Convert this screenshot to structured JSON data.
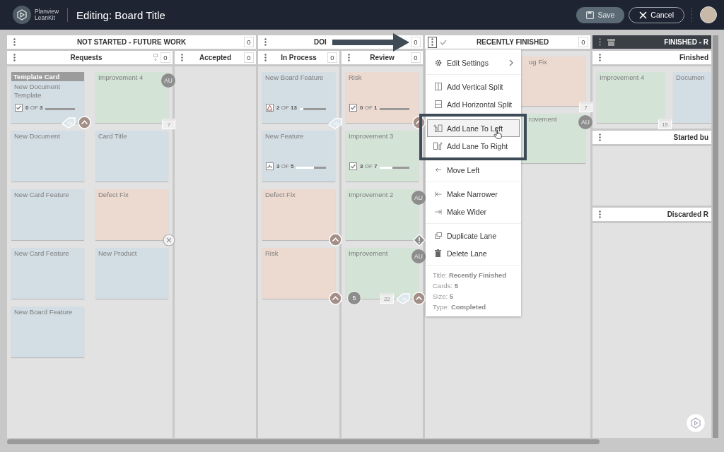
{
  "header": {
    "brand_top": "Planview",
    "brand_bottom": "LeanKit",
    "title": "Editing: Board Title",
    "save": "Save",
    "cancel": "Cancel"
  },
  "columns": [
    {
      "title": "NOT STARTED - FUTURE WORK",
      "count": "0",
      "kind": "normal",
      "menu_open": false,
      "lanes": [
        {
          "title": "Requests",
          "count": "0",
          "wip_icon": true,
          "cards": [
            {
              "header": "Template Card",
              "title": "New Document Template",
              "color": "#d3dde4",
              "progress": {
                "kind": "check",
                "done": "0",
                "of": "OF",
                "total": "3",
                "level": 0
              },
              "badges": [
                {
                  "kind": "tag"
                },
                {
                  "kind": "priority"
                }
              ]
            },
            {
              "title": "Improvement 4",
              "color": "#d3e3d6",
              "badges": [
                {
                  "kind": "avatar",
                  "text": "AU"
                },
                {
                  "kind": "calendar",
                  "text": "?"
                }
              ]
            },
            {
              "title": "New Document",
              "color": "#d3dde4"
            },
            {
              "title": "Card Title",
              "color": "#d3dde4"
            },
            {
              "title": "New Card Feature",
              "color": "#d3dde4"
            },
            {
              "title": "Defect Fix",
              "color": "#ecd9cf",
              "badges": [
                {
                  "kind": "blocked"
                }
              ]
            },
            {
              "title": "New Card Feature",
              "color": "#d3dde4"
            },
            {
              "title": "New Product",
              "color": "#d3dde4"
            },
            {
              "title": "New Board Feature",
              "color": "#d3dde4"
            }
          ]
        },
        {
          "title": "Accepted",
          "count": "0",
          "wip_icon": false
        }
      ]
    },
    {
      "title": "DOI",
      "count": "0",
      "kind": "normal",
      "menu_open": false,
      "lanes": [
        {
          "title": "In Process",
          "count": "0",
          "wip_icon": false,
          "cards": [
            {
              "title": "New Board Feature",
              "color": "#d3dde4",
              "progress": {
                "kind": "warning",
                "done": "2",
                "of": "OF",
                "total": "13",
                "level": 0.15
              },
              "badges": [
                {
                  "kind": "tag"
                }
              ]
            },
            {
              "title": "New Feature",
              "color": "#d3dde4",
              "progress": {
                "kind": "tree",
                "done": "3",
                "of": "OF",
                "total": "5",
                "level": 0.6
              }
            },
            {
              "title": "Defect Fix",
              "color": "#ecd9cf",
              "badges": [
                {
                  "kind": "priority"
                }
              ]
            },
            {
              "title": "Risk",
              "color": "#ecd9cf",
              "badges": [
                {
                  "kind": "priority"
                }
              ]
            }
          ]
        },
        {
          "title": "Review",
          "count": "0",
          "wip_icon": false,
          "cards": [
            {
              "title": "Risk",
              "color": "#ecd9cf",
              "progress": {
                "kind": "check",
                "done": "0",
                "of": "OF",
                "total": "1",
                "level": 0
              },
              "badges": [
                {
                  "kind": "priority"
                }
              ]
            },
            {
              "title": "Improvement 3",
              "color": "#d3e3d6",
              "progress": {
                "kind": "check",
                "done": "3",
                "of": "OF",
                "total": "7",
                "level": 0.43
              }
            },
            {
              "title": "Improvement 2",
              "color": "#d3e3d6",
              "badges": [
                {
                  "kind": "avatar",
                  "text": "AU"
                },
                {
                  "kind": "alert"
                }
              ]
            },
            {
              "title": "Improvement",
              "color": "#d3e3d6",
              "badges": [
                {
                  "kind": "avatar",
                  "text": "AU"
                },
                {
                  "kind": "count",
                  "text": "5"
                },
                {
                  "kind": "calendar",
                  "text": "22"
                },
                {
                  "kind": "tag"
                },
                {
                  "kind": "priority"
                }
              ]
            }
          ]
        }
      ]
    },
    {
      "title": "RECENTLY FINISHED",
      "count": "0",
      "kind": "completed",
      "menu_open": true,
      "lanes": [
        {
          "cards": [
            {
              "title": "ug Fix",
              "color": "#ecd9cf",
              "badges": [
                {
                  "kind": "calendar",
                  "text": "7"
                }
              ]
            },
            {
              "title": "rovement",
              "color": "#d3e3d6",
              "badges": [
                {
                  "kind": "avatar",
                  "text": "AU"
                }
              ]
            }
          ]
        }
      ]
    },
    {
      "title": "FINISHED - R",
      "kind": "archive",
      "menu_open": false,
      "lanes": [
        {
          "title": "Finished",
          "cards": [
            {
              "title": "Improvement 4",
              "color": "#d3e3d6",
              "badges": [
                {
                  "kind": "calendar",
                  "text": "15"
                }
              ]
            },
            {
              "title": "Documen",
              "color": "#d3dde4"
            }
          ]
        },
        {
          "title": "Started bu"
        },
        {
          "title": "Discarded R"
        }
      ]
    }
  ],
  "lane_menu": {
    "groups": [
      [
        {
          "label": "Edit Settings",
          "kind": "gear",
          "submenu": true,
          "selected": false
        }
      ],
      [
        {
          "label": "Add Vertical Split",
          "kind": "vsplit",
          "submenu": false,
          "selected": false
        },
        {
          "label": "Add Horizontal Split",
          "kind": "hsplit",
          "submenu": false,
          "selected": false
        }
      ],
      [
        {
          "label": "Add Lane To Left",
          "kind": "lane-left",
          "submenu": false,
          "selected": true
        },
        {
          "label": "Add Lane To Right",
          "kind": "lane-right",
          "submenu": false,
          "selected": false
        }
      ],
      [
        {
          "label": "Move Left",
          "kind": "arrow-left",
          "submenu": false,
          "selected": false
        }
      ],
      [
        {
          "label": "Make Narrower",
          "kind": "narrower",
          "submenu": false,
          "selected": false
        },
        {
          "label": "Make Wider",
          "kind": "wider",
          "submenu": false,
          "selected": false
        }
      ],
      [
        {
          "label": "Duplicate Lane",
          "kind": "duplicate",
          "submenu": false,
          "selected": false
        },
        {
          "label": "Delete Lane",
          "kind": "trash",
          "submenu": false,
          "selected": false
        }
      ]
    ],
    "info": [
      {
        "label": "Title:",
        "value": "Recently Finished"
      },
      {
        "label": "Cards:",
        "value": "5"
      },
      {
        "label": "Size:",
        "value": "5"
      },
      {
        "label": "Type:",
        "value": "Completed"
      }
    ]
  }
}
